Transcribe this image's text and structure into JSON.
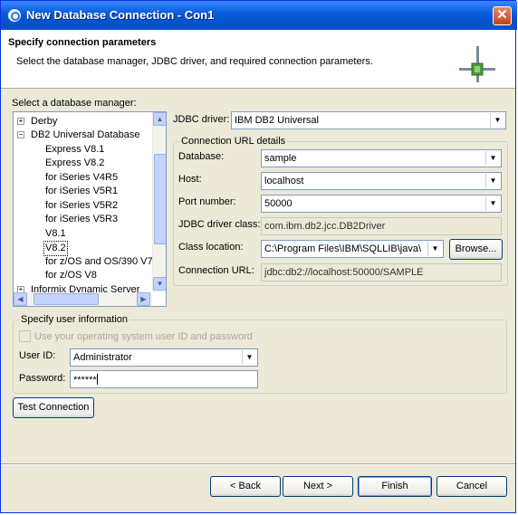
{
  "window": {
    "title": "New Database Connection - Con1",
    "close_glyph": "✕"
  },
  "header": {
    "title": "Specify connection parameters",
    "description": "Select the database manager, JDBC driver, and required connection parameters."
  },
  "db_manager": {
    "label": "Select a database manager:",
    "items": [
      {
        "label": "Derby",
        "expander": "+"
      },
      {
        "label": "DB2 Universal Database",
        "expander": "−"
      },
      {
        "label": "Express V8.1"
      },
      {
        "label": "Express V8.2"
      },
      {
        "label": "for iSeries V4R5"
      },
      {
        "label": "for iSeries V5R1"
      },
      {
        "label": "for iSeries V5R2"
      },
      {
        "label": "for iSeries V5R3"
      },
      {
        "label": "V8.1"
      },
      {
        "label": "V8.2",
        "selected": true
      },
      {
        "label": "for z/OS and OS/390 V7"
      },
      {
        "label": "for z/OS V8"
      },
      {
        "label": "Informix Dynamic Server",
        "expander": "+"
      }
    ]
  },
  "jdbc_driver": {
    "label": "JDBC driver:",
    "value": "IBM DB2 Universal"
  },
  "url_details": {
    "legend": "Connection URL details",
    "database": {
      "label": "Database:",
      "value": "sample"
    },
    "host": {
      "label": "Host:",
      "value": "localhost"
    },
    "port": {
      "label": "Port number:",
      "value": "50000"
    },
    "driver_class": {
      "label": "JDBC driver class:",
      "value": "com.ibm.db2.jcc.DB2Driver"
    },
    "class_location": {
      "label": "Class location:",
      "value": "C:\\Program Files\\IBM\\SQLLIB\\java\\",
      "browse_label": "Browse..."
    },
    "connection_url": {
      "label": "Connection URL:",
      "value": "jdbc:db2://localhost:50000/SAMPLE"
    }
  },
  "user_info": {
    "legend": "Specify user information",
    "use_os_checkbox": {
      "label": "Use your operating system user ID and password",
      "checked": false
    },
    "user_id": {
      "label": "User ID:",
      "value": "Administrator"
    },
    "password": {
      "label": "Password:",
      "value": "******"
    }
  },
  "buttons": {
    "test_connection": "Test Connection",
    "back": "< Back",
    "next": "Next >",
    "finish": "Finish",
    "cancel": "Cancel"
  },
  "icons": {
    "title": "database-connection-icon",
    "header": "connection-plug-icon",
    "dropdown": "▼",
    "scroll_up": "▲",
    "scroll_down": "▼",
    "scroll_left": "◀",
    "scroll_right": "▶"
  }
}
